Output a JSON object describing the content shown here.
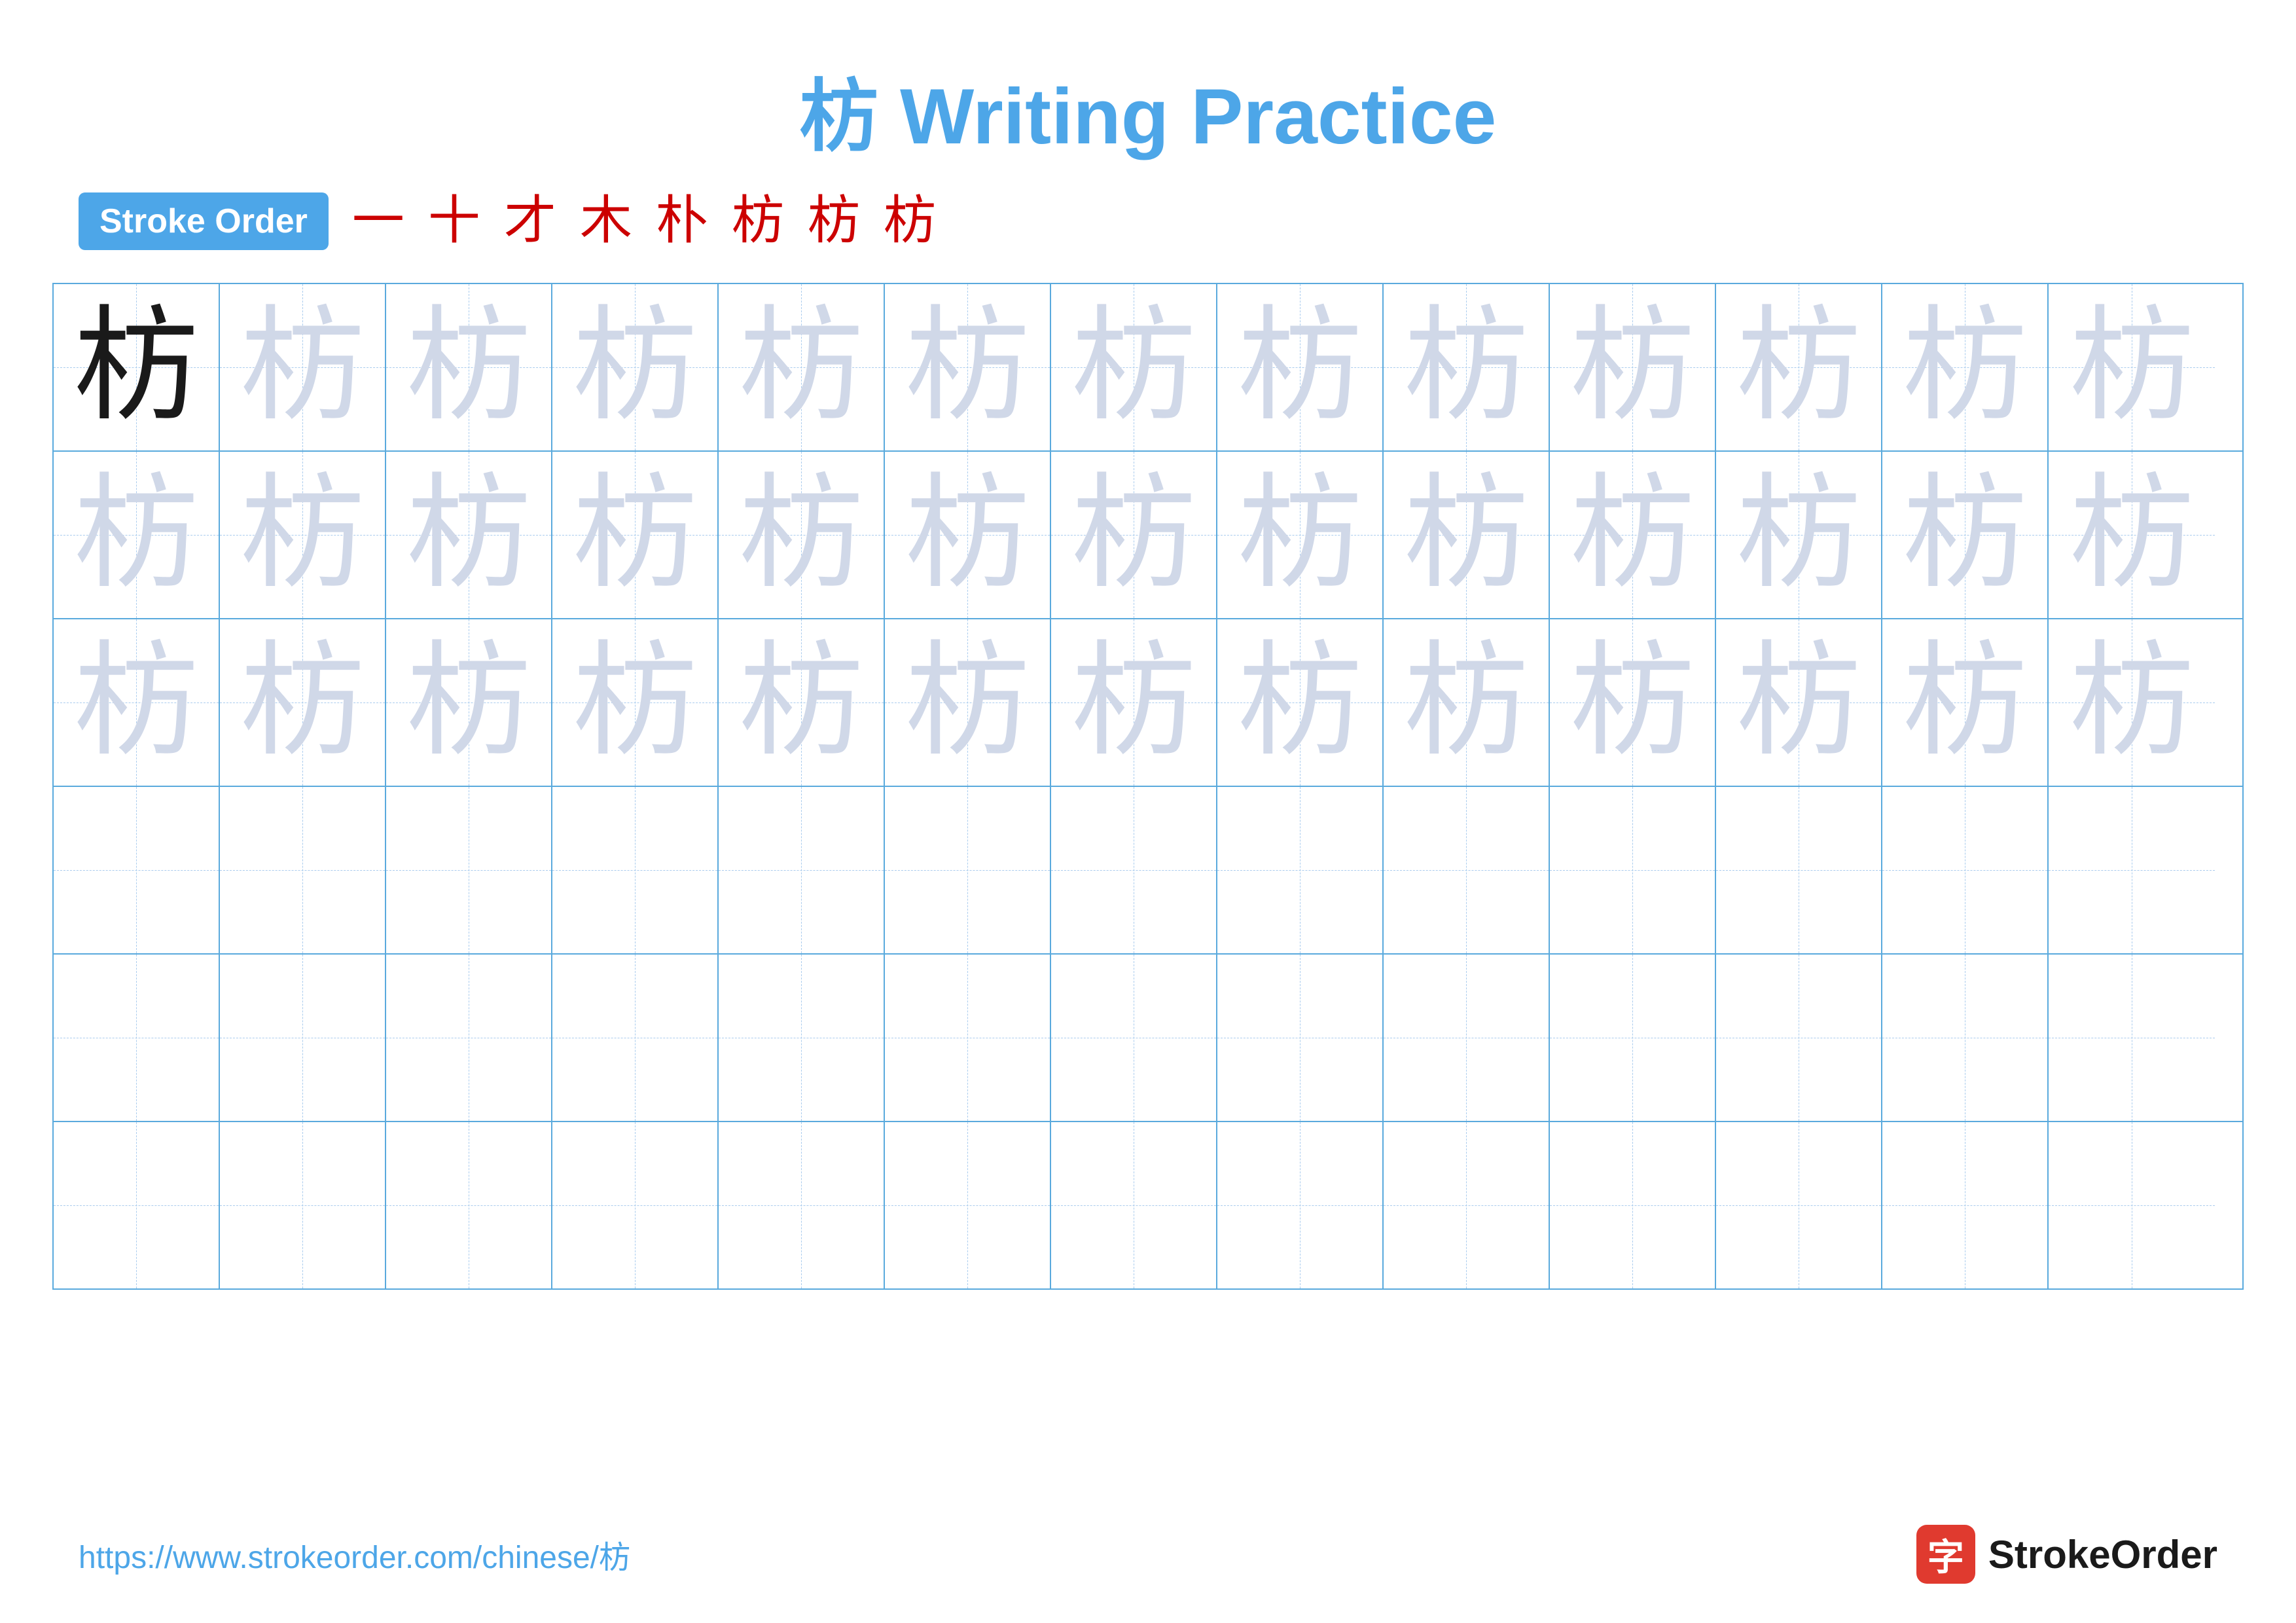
{
  "title": {
    "char": "枋",
    "text": " Writing Practice"
  },
  "stroke_order": {
    "badge_label": "Stroke Order",
    "steps": [
      "一",
      "十",
      "才",
      "木",
      "朴",
      "枋",
      "枋",
      "枋"
    ]
  },
  "grid": {
    "rows": 6,
    "cols": 13,
    "char": "枋",
    "solid_row": 0,
    "solid_col": 0,
    "light_rows": [
      0,
      1,
      2
    ],
    "empty_rows": [
      3,
      4,
      5
    ]
  },
  "footer": {
    "url": "https://www.strokeorder.com/chinese/枋",
    "logo_char": "字",
    "logo_text": "StrokeOrder"
  }
}
